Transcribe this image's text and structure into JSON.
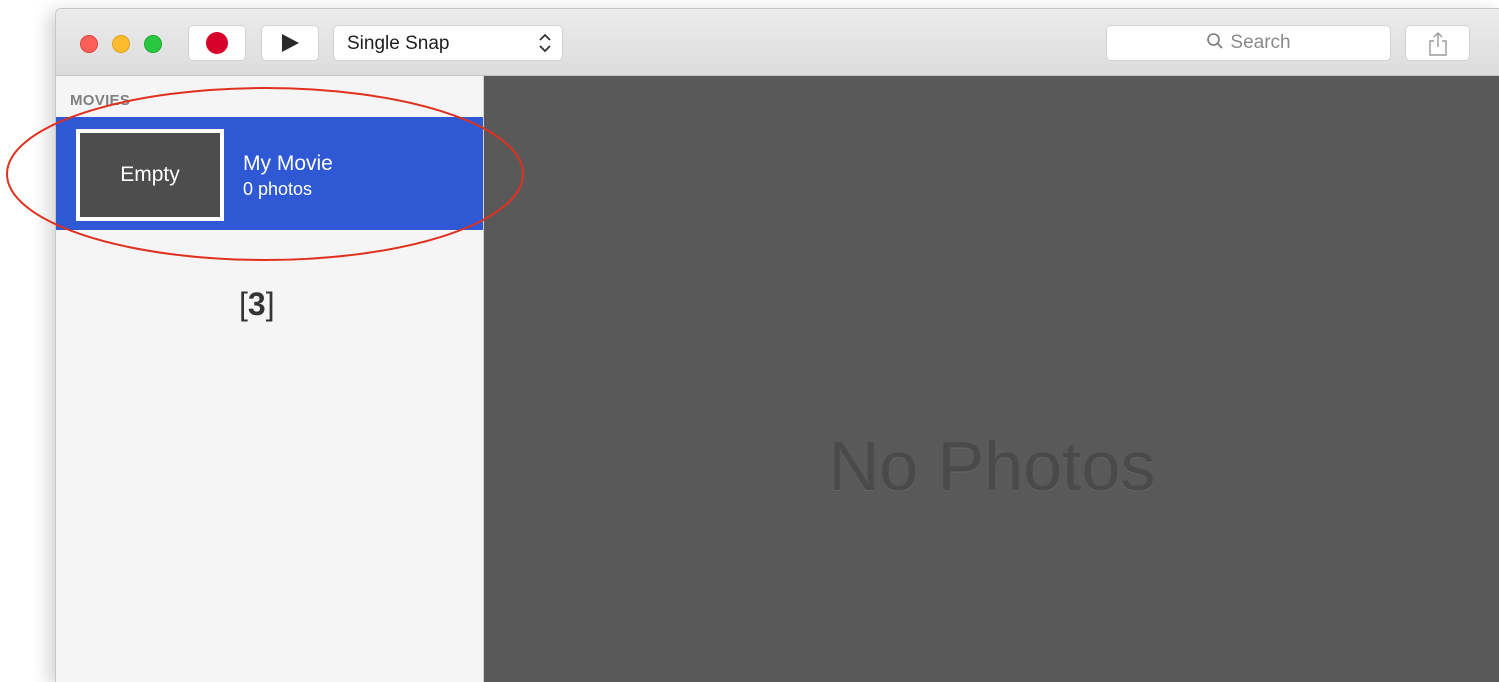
{
  "toolbar": {
    "mode_select": {
      "selected": "Single Snap"
    },
    "search": {
      "placeholder": "Search"
    }
  },
  "sidebar": {
    "section_header": "MOVIES",
    "items": [
      {
        "thumbnail_label": "Empty",
        "title": "My Movie",
        "count_label": "0 photos",
        "selected": true
      }
    ]
  },
  "annotation": {
    "marker": "3"
  },
  "main": {
    "empty_state": "No Photos"
  },
  "colors": {
    "selection": "#2f58d4",
    "record": "#d6002a",
    "annotation_circle": "#e0301e",
    "content_background": "#595959"
  },
  "icons": [
    "record-icon",
    "play-icon",
    "updown-chevron-icon",
    "search-icon",
    "share-icon"
  ]
}
